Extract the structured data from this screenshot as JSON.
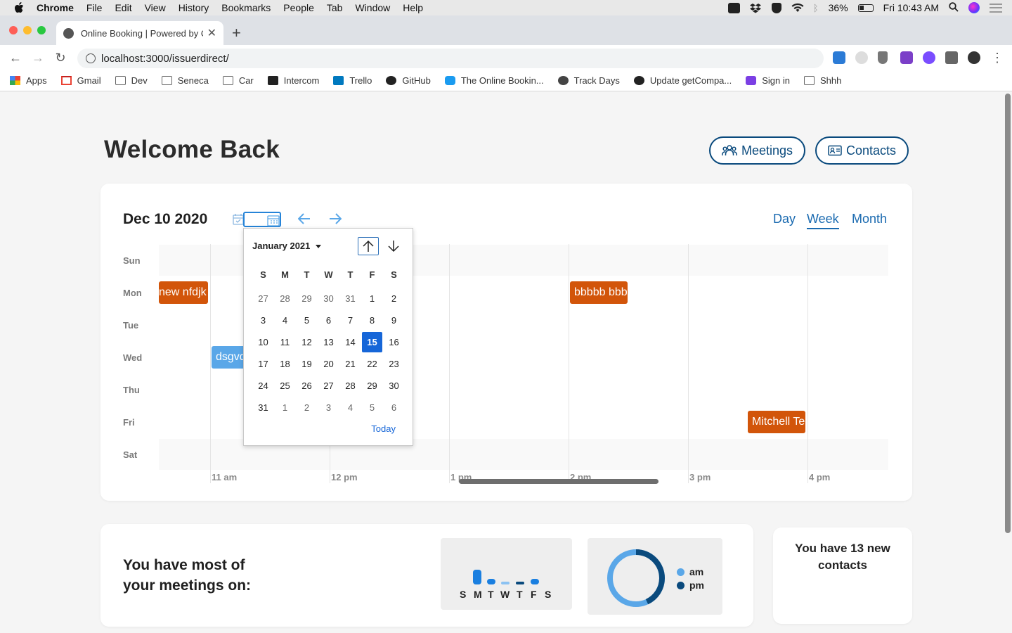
{
  "menubar": {
    "app": "Chrome",
    "items": [
      "File",
      "Edit",
      "View",
      "History",
      "Bookmarks",
      "People",
      "Tab",
      "Window",
      "Help"
    ],
    "battery": "36%",
    "clock": "Fri 10:43 AM"
  },
  "browser": {
    "tab_title": "Online Booking | Powered by O",
    "url": "localhost:3000/issuerdirect/",
    "bookmarks": [
      {
        "label": "Apps",
        "icon": "apps-grid-icon"
      },
      {
        "label": "Gmail",
        "icon": "gmail-icon"
      },
      {
        "label": "Dev",
        "icon": "folder-icon"
      },
      {
        "label": "Seneca",
        "icon": "folder-icon"
      },
      {
        "label": "Car",
        "icon": "folder-icon"
      },
      {
        "label": "Intercom",
        "icon": "intercom-icon"
      },
      {
        "label": "Trello",
        "icon": "trello-icon"
      },
      {
        "label": "GitHub",
        "icon": "github-icon"
      },
      {
        "label": "The Online Bookin...",
        "icon": "booking-icon"
      },
      {
        "label": "Track Days",
        "icon": "globe-icon"
      },
      {
        "label": "Update getCompa...",
        "icon": "github-icon"
      },
      {
        "label": "Sign in",
        "icon": "sign-in-icon"
      },
      {
        "label": "Shhh",
        "icon": "folder-icon"
      }
    ]
  },
  "header": {
    "title": "Welcome Back",
    "meetings_label": "Meetings",
    "contacts_label": "Contacts"
  },
  "calendar": {
    "date_label": "Dec 10 2020",
    "views": [
      "Day",
      "Week",
      "Month"
    ],
    "active_view": "Week",
    "days": [
      "Sun",
      "Mon",
      "Tue",
      "Wed",
      "Thu",
      "Fri",
      "Sat"
    ],
    "hours": [
      "11 am",
      "12 pm",
      "1 pm",
      "2 pm",
      "3 pm",
      "4 pm"
    ],
    "events": [
      {
        "label": "new nfdjk",
        "day": "Mon",
        "color": "#d2550a"
      },
      {
        "label": "bbbbb bbb",
        "day": "Mon",
        "color": "#d2550a"
      },
      {
        "label": "dsgvds",
        "day": "Wed",
        "color": "#5aa7e8"
      },
      {
        "label": "Mitchell Te",
        "day": "Fri",
        "color": "#d2550a"
      }
    ]
  },
  "datepicker": {
    "month_label": "January 2021",
    "weekday_headers": [
      "S",
      "M",
      "T",
      "W",
      "T",
      "F",
      "S"
    ],
    "weeks": [
      [
        "27",
        "28",
        "29",
        "30",
        "31",
        "1",
        "2"
      ],
      [
        "3",
        "4",
        "5",
        "6",
        "7",
        "8",
        "9"
      ],
      [
        "10",
        "11",
        "12",
        "13",
        "14",
        "15",
        "16"
      ],
      [
        "17",
        "18",
        "19",
        "20",
        "21",
        "22",
        "23"
      ],
      [
        "24",
        "25",
        "26",
        "27",
        "28",
        "29",
        "30"
      ],
      [
        "31",
        "1",
        "2",
        "3",
        "4",
        "5",
        "6"
      ]
    ],
    "selected": "15",
    "today_label": "Today"
  },
  "stats": {
    "most_meetings_label": "You have most of your meetings on:",
    "weekday_letters": [
      "S",
      "M",
      "T",
      "W",
      "T",
      "F",
      "S"
    ],
    "am_label": "am",
    "pm_label": "pm",
    "am_color": "#5aa7e8",
    "pm_color": "#0a4a7d",
    "contacts_text": "You have 13 new contacts"
  }
}
